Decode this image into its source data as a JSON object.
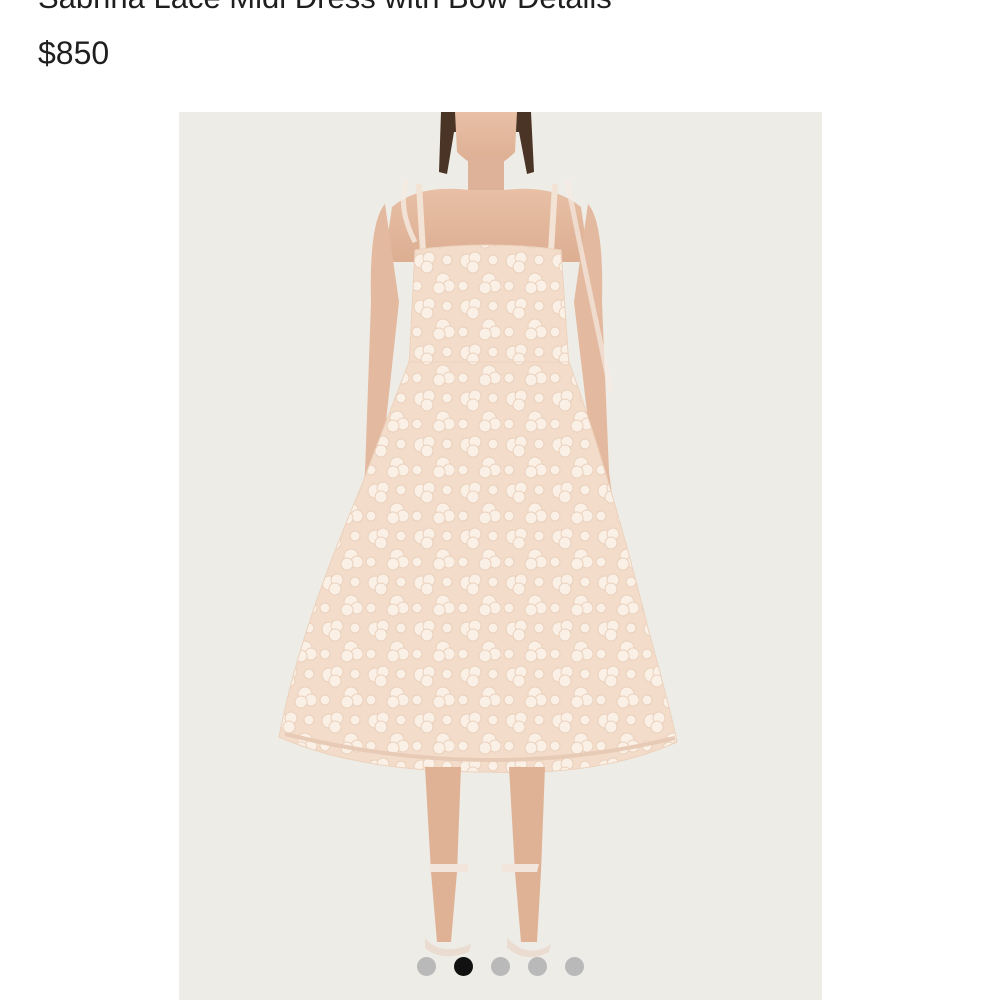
{
  "product": {
    "title": "Sabrina Lace Midi Dress with Bow Details",
    "price": "$850"
  },
  "gallery": {
    "image_name": "dress-photo",
    "background_color": "#eeece6",
    "dress_color": "#f6e6d6",
    "active_index": 1,
    "dots": [
      {
        "name": "gallery-dot-1"
      },
      {
        "name": "gallery-dot-2"
      },
      {
        "name": "gallery-dot-3"
      },
      {
        "name": "gallery-dot-4"
      },
      {
        "name": "gallery-dot-5"
      }
    ]
  }
}
